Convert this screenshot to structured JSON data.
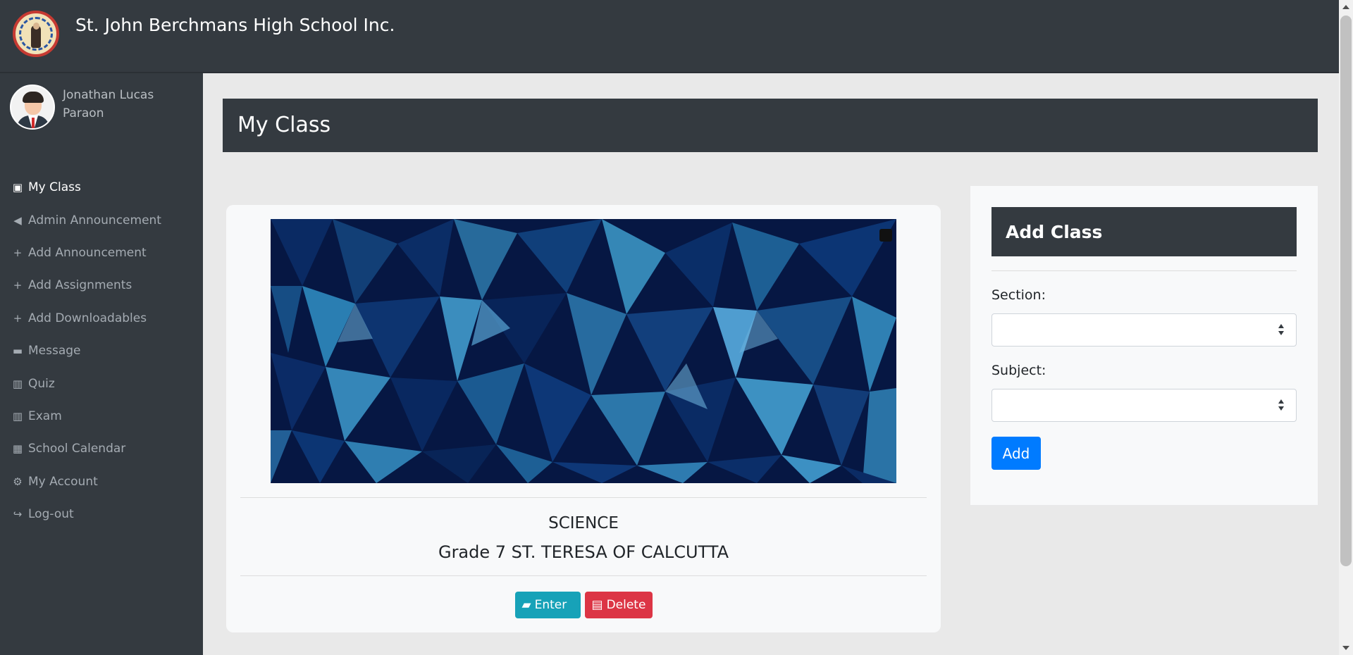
{
  "header": {
    "school_name": "St. John Berchmans High School Inc."
  },
  "user": {
    "name": "Jonathan Lucas Paraon"
  },
  "sidebar": {
    "items": [
      {
        "label": "My Class",
        "icon": "chalkboard-user-icon",
        "active": true
      },
      {
        "label": "Admin Announcement",
        "icon": "bullhorn-icon",
        "active": false
      },
      {
        "label": "Add Announcement",
        "icon": "plus-icon",
        "active": false
      },
      {
        "label": "Add Assignments",
        "icon": "plus-icon",
        "active": false
      },
      {
        "label": "Add Downloadables",
        "icon": "plus-icon",
        "active": false
      },
      {
        "label": "Message",
        "icon": "comment-icon",
        "active": false
      },
      {
        "label": "Quiz",
        "icon": "book-open-icon",
        "active": false
      },
      {
        "label": "Exam",
        "icon": "book-open-icon",
        "active": false
      },
      {
        "label": "School Calendar",
        "icon": "calendar-icon",
        "active": false
      },
      {
        "label": "My Account",
        "icon": "gears-icon",
        "active": false
      },
      {
        "label": "Log-out",
        "icon": "sign-out-icon",
        "active": false
      }
    ]
  },
  "main": {
    "title": "My Class",
    "class_card": {
      "subject": "SCIENCE",
      "grade_section": "Grade 7 ST. TERESA OF CALCUTTA",
      "enter_label": "Enter",
      "delete_label": "Delete"
    }
  },
  "add_class": {
    "title": "Add Class",
    "section_label": "Section:",
    "section_value": "",
    "subject_label": "Subject:",
    "subject_value": "",
    "add_label": "Add"
  },
  "colors": {
    "sidebar": "#343a40",
    "primary": "#007bff",
    "info": "#17a2b8",
    "danger": "#dc3545"
  }
}
